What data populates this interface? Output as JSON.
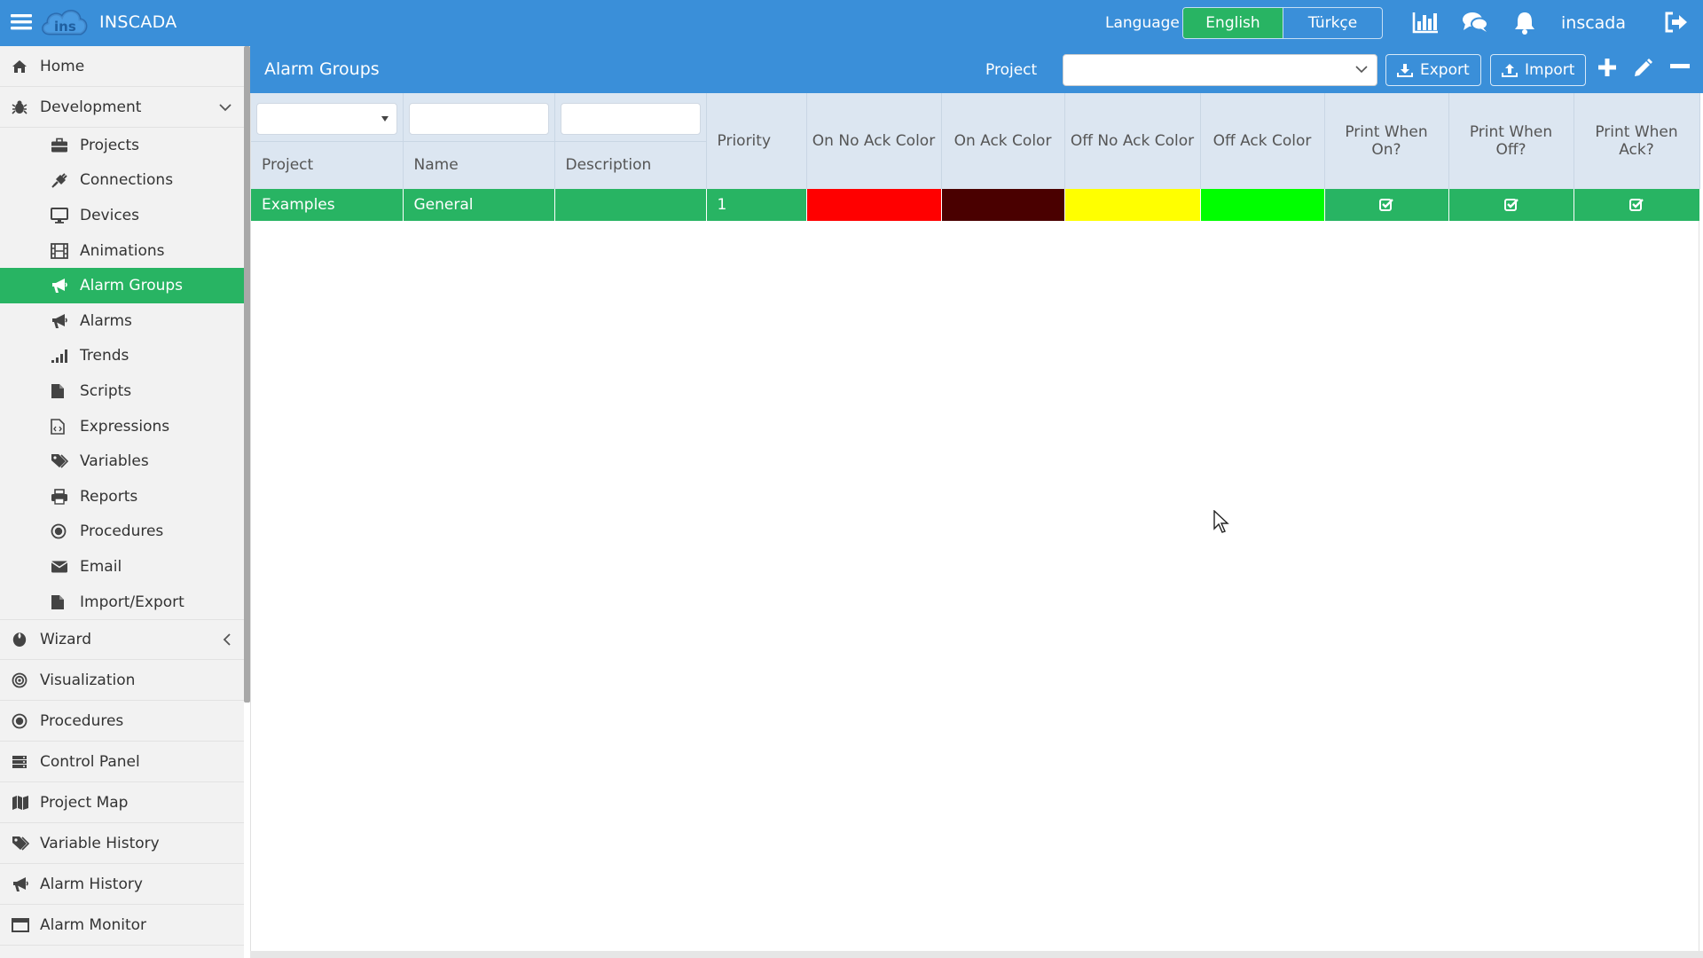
{
  "app": {
    "name": "INSCADA"
  },
  "topbar": {
    "language_label": "Language",
    "languages": [
      {
        "label": "English",
        "active": true
      },
      {
        "label": "Türkçe",
        "active": false
      }
    ],
    "username": "inscada",
    "icons": [
      "bar-chart-icon",
      "comments-icon",
      "bell-icon",
      "sign-out-icon"
    ]
  },
  "sidebar": {
    "items": [
      {
        "label": "Home",
        "icon": "home-icon"
      },
      {
        "label": "Development",
        "icon": "bug-icon",
        "expanded": true,
        "children": [
          {
            "label": "Projects",
            "icon": "briefcase-icon"
          },
          {
            "label": "Connections",
            "icon": "plug-icon"
          },
          {
            "label": "Devices",
            "icon": "desktop-icon"
          },
          {
            "label": "Animations",
            "icon": "film-icon"
          },
          {
            "label": "Alarm Groups",
            "icon": "bullhorn-icon",
            "active": true
          },
          {
            "label": "Alarms",
            "icon": "bullhorn-icon"
          },
          {
            "label": "Trends",
            "icon": "signal-icon"
          },
          {
            "label": "Scripts",
            "icon": "file-icon"
          },
          {
            "label": "Expressions",
            "icon": "file-code-icon"
          },
          {
            "label": "Variables",
            "icon": "tags-icon"
          },
          {
            "label": "Reports",
            "icon": "print-icon"
          },
          {
            "label": "Procedures",
            "icon": "dot-circle-icon"
          },
          {
            "label": "Email",
            "icon": "envelope-icon"
          },
          {
            "label": "Import/Export",
            "icon": "file-icon"
          }
        ]
      },
      {
        "label": "Wizard",
        "icon": "rebel-icon",
        "expanded": false
      },
      {
        "label": "Visualization",
        "icon": "bullseye-icon"
      },
      {
        "label": "Procedures",
        "icon": "dot-circle-icon"
      },
      {
        "label": "Control Panel",
        "icon": "server-icon"
      },
      {
        "label": "Project Map",
        "icon": "map-icon"
      },
      {
        "label": "Variable History",
        "icon": "tags-icon"
      },
      {
        "label": "Alarm History",
        "icon": "bullhorn-icon"
      },
      {
        "label": "Alarm Monitor",
        "icon": "window-icon"
      }
    ]
  },
  "panel": {
    "title": "Alarm Groups",
    "project_label": "Project",
    "project_value": "",
    "export_label": "Export",
    "import_label": "Import"
  },
  "table": {
    "columns": [
      "Project",
      "Name",
      "Description",
      "Priority",
      "On No Ack Color",
      "On Ack Color",
      "Off No Ack Color",
      "Off Ack Color",
      "Print When On?",
      "Print When Off?",
      "Print When Ack?"
    ],
    "filters": {
      "project": "",
      "name": "",
      "description": ""
    },
    "rows": [
      {
        "project": "Examples",
        "name": "General",
        "description": "",
        "priority": "1",
        "on_no_ack_color": "#ff0000",
        "on_ack_color": "#4a0000",
        "off_no_ack_color": "#ffff00",
        "off_ack_color": "#00ff00",
        "print_when_on": true,
        "print_when_off": true,
        "print_when_ack": true
      }
    ]
  },
  "colors": {
    "primary": "#3a8fd9",
    "active": "#28b463",
    "header_bg": "#dce6f1",
    "sidebar_bg": "#f2f2f2"
  }
}
